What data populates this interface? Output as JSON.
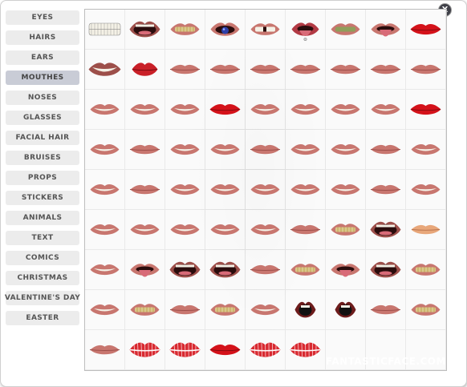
{
  "close_label": "X",
  "categories": [
    {
      "label": "EYES"
    },
    {
      "label": "HAIRS"
    },
    {
      "label": "EARS"
    },
    {
      "label": "MOUTHES",
      "active": true
    },
    {
      "label": "NOSES"
    },
    {
      "label": "GLASSES"
    },
    {
      "label": "FACIAL HAIR"
    },
    {
      "label": "BRUISES"
    },
    {
      "label": "PROPS"
    },
    {
      "label": "STICKERS"
    },
    {
      "label": "ANIMALS"
    },
    {
      "label": "TEXT"
    },
    {
      "label": "COMICS"
    },
    {
      "label": "CHRISTMAS"
    },
    {
      "label": "VALENTINE'S DAY"
    },
    {
      "label": "EASTER"
    }
  ],
  "mouth_rows": [
    [
      "teeth-only",
      "open-wide",
      "grin-gold",
      "tongue-ball",
      "gap-grin",
      "tongue-piercing",
      "grin-green",
      "tongue-out",
      "red-lips"
    ],
    [
      "big-smile",
      "red-pout",
      "closed",
      "closed",
      "closed",
      "closed",
      "closed",
      "closed",
      "closed"
    ],
    [
      "smile",
      "smile",
      "smile",
      "red-lips",
      "smile",
      "smile",
      "smile",
      "smile",
      "red-lips"
    ],
    [
      "smile",
      "closed",
      "smile",
      "smile",
      "closed",
      "smile",
      "smile",
      "closed",
      "smile"
    ],
    [
      "smile",
      "closed",
      "smile",
      "smile",
      "smile",
      "smile",
      "smile",
      "closed",
      "smile"
    ],
    [
      "smile",
      "smile",
      "smile",
      "smile",
      "smile",
      "closed",
      "grin-gold",
      "open-wide",
      "pale-lips"
    ],
    [
      "smile",
      "tongue-out",
      "open-wide",
      "open-wide",
      "closed",
      "grin-gold",
      "tongue-out",
      "open-wide",
      "grin-gold"
    ],
    [
      "smile",
      "grin-gold",
      "closed",
      "grin-gold",
      "smile",
      "dark-open",
      "dark-open",
      "closed",
      "grin-gold"
    ],
    [
      "closed",
      "kiss-print",
      "kiss-print",
      "red-lips",
      "kiss-print",
      "kiss-print",
      "empty",
      "empty",
      "empty"
    ]
  ],
  "watermark": "FANTASTICFACE.COM",
  "colors": {
    "lip": "#c8766f",
    "lip_dark": "#9d4f4a",
    "red": "#d4121a",
    "teeth": "#f4f1e6",
    "gold": "#b8923a",
    "green_teeth": "#8f9e5a",
    "tongue": "#d86b78",
    "mouth_dark": "#2a0d0d"
  }
}
